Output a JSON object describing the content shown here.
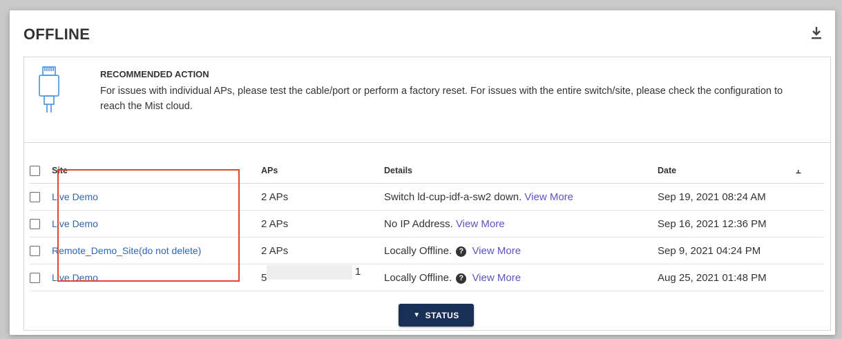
{
  "panel": {
    "title": "OFFLINE"
  },
  "recommendation": {
    "icon": "ethernet-cable-icon",
    "heading": "RECOMMENDED ACTION",
    "text": "For issues with individual APs, please test the cable/port or perform a factory reset. For issues with the entire switch/site, please check the configuration to reach the Mist cloud."
  },
  "table": {
    "headers": {
      "site": "Site",
      "aps": "APs",
      "details": "Details",
      "date": "Date"
    },
    "rows": [
      {
        "site": "Live Demo",
        "aps": "2 APs",
        "details": "Switch ld-cup-idf-a-sw2 down.",
        "help": false,
        "link": "View More",
        "date": "Sep 19, 2021 08:24 AM"
      },
      {
        "site": "Live Demo",
        "aps": "2 APs",
        "details": "No IP Address.",
        "help": false,
        "link": "View More",
        "date": "Sep 16, 2021 12:36 PM"
      },
      {
        "site": "Remote_Demo_Site(do not delete)",
        "aps": "2 APs",
        "details": "Locally Offline.",
        "help": true,
        "link": "View More",
        "date": "Sep 9, 2021 04:24 PM"
      },
      {
        "site": "Live Demo",
        "aps": "5",
        "aps_tail": "1",
        "details": "Locally Offline.",
        "help": true,
        "link": "View More",
        "date": "Aug 25, 2021 01:48 PM"
      }
    ]
  },
  "status_button": {
    "label": "STATUS"
  },
  "colors": {
    "link": "#2b67b3",
    "view_more": "#5b55c0",
    "button_bg": "#1a2f55",
    "highlight": "#e04432"
  }
}
